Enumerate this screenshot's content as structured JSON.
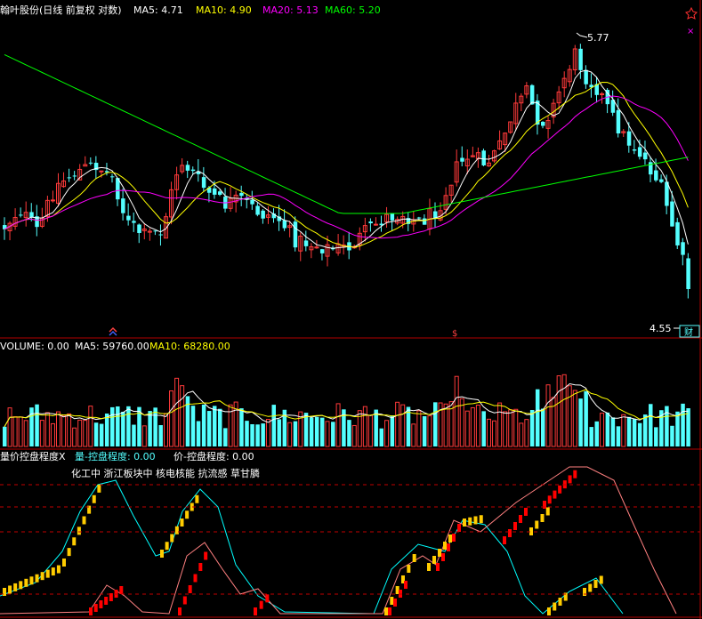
{
  "colors": {
    "background": "#000000",
    "border": "#b00000",
    "up": "#ff3a3a",
    "down": "#54ffff",
    "ma5": "#ffffff",
    "ma10": "#ffff00",
    "ma20": "#ff00ff",
    "ma60": "#00ff00",
    "text": "#ffffff",
    "bar_yellow": "#ffcc00",
    "bar_red": "#ff0000",
    "line_cyan": "#00ffff",
    "line_pink": "#ff8080"
  },
  "price_panel": {
    "title": "翰叶股份(日线 前复权 对数)",
    "ma5_label": "MA5: 4.71",
    "ma10_label": "MA10: 4.90",
    "ma20_label": "MA20: 5.13",
    "ma60_label": "MA60: 5.20",
    "high_label": "5.77",
    "low_label": "4.55",
    "corner_icon": "pin-icon",
    "right_mark": "×",
    "bottom_mark": "$",
    "finance_tag": "财"
  },
  "volume_panel": {
    "label_volume": "VOLUME: 0.00",
    "label_ma5": "MA5: 59760.00",
    "label_ma10": "MA10: 68280.00"
  },
  "indicator_panel": {
    "label_main": "量价控盘程度X",
    "label_vol": "量-控盘程度: 0.00",
    "label_price": "价-控盘程度: 0.00",
    "sector_text": "化工中 浙江板块中 核电核能 抗流感 草甘膦"
  },
  "chart_data": [
    {
      "type": "candlestick",
      "title": "翰叶股份(日线 前复权 对数)",
      "annotations": [
        "5.77",
        "4.55"
      ],
      "series": [
        {
          "name": "MA5",
          "last": 4.71
        },
        {
          "name": "MA10",
          "last": 4.9
        },
        {
          "name": "MA20",
          "last": 5.13
        },
        {
          "name": "MA60",
          "last": 5.2
        }
      ],
      "ylim": [
        4.55,
        5.77
      ]
    },
    {
      "type": "bar",
      "series": [
        {
          "name": "VOLUME",
          "last": 0.0
        },
        {
          "name": "MA5",
          "last": 59760.0
        },
        {
          "name": "MA10",
          "last": 68280.0
        }
      ]
    },
    {
      "type": "bar",
      "title": "量价控盘程度X",
      "series": [
        {
          "name": "量-控盘程度",
          "last": 0.0
        },
        {
          "name": "价-控盘程度",
          "last": 0.0
        }
      ]
    }
  ]
}
